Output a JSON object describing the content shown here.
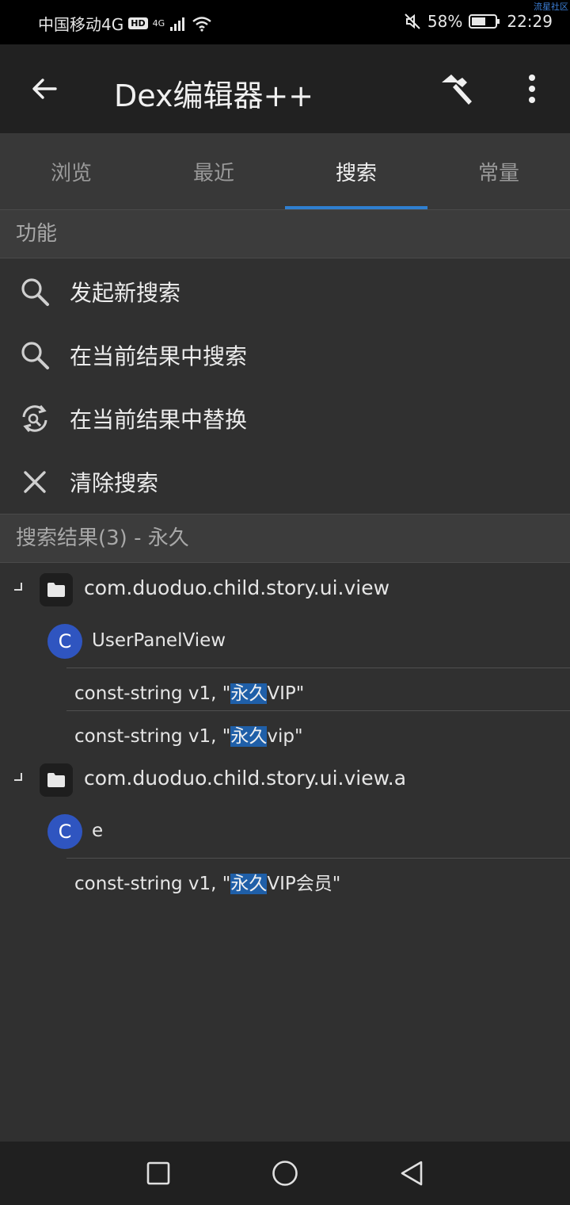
{
  "status_bar": {
    "carrier": "中国移动4G",
    "hd": "HD",
    "network": "4G",
    "battery": "58%",
    "time": "22:29",
    "watermark": "流星社区"
  },
  "app_bar": {
    "title": "Dex编辑器++"
  },
  "tabs": [
    {
      "label": "浏览"
    },
    {
      "label": "最近"
    },
    {
      "label": "搜索"
    },
    {
      "label": "常量"
    }
  ],
  "functions": {
    "header": "功能",
    "items": [
      {
        "label": "发起新搜索",
        "icon": "search-icon"
      },
      {
        "label": "在当前结果中搜索",
        "icon": "search-icon"
      },
      {
        "label": "在当前结果中替换",
        "icon": "replace-icon"
      },
      {
        "label": "清除搜索",
        "icon": "close-icon"
      }
    ]
  },
  "results": {
    "header": "搜索结果(3) - 永久",
    "groups": [
      {
        "package": "com.duoduo.child.story.ui.view",
        "class_badge": "C",
        "class_name": "UserPanelView",
        "lines": [
          {
            "prefix": "const-string v1, \"",
            "match": "永久",
            "suffix": "VIP\""
          },
          {
            "prefix": "const-string v1, \"",
            "match": "永久",
            "suffix": "vip\""
          }
        ]
      },
      {
        "package": "com.duoduo.child.story.ui.view.a",
        "class_badge": "C",
        "class_name": "e",
        "lines": [
          {
            "prefix": "const-string v1, \"",
            "match": "永久",
            "suffix": "VIP会员\""
          }
        ]
      }
    ]
  },
  "colors": {
    "accent": "#2f7fd0",
    "class_badge": "#2f55c0",
    "highlight": "#1f5fa8"
  }
}
